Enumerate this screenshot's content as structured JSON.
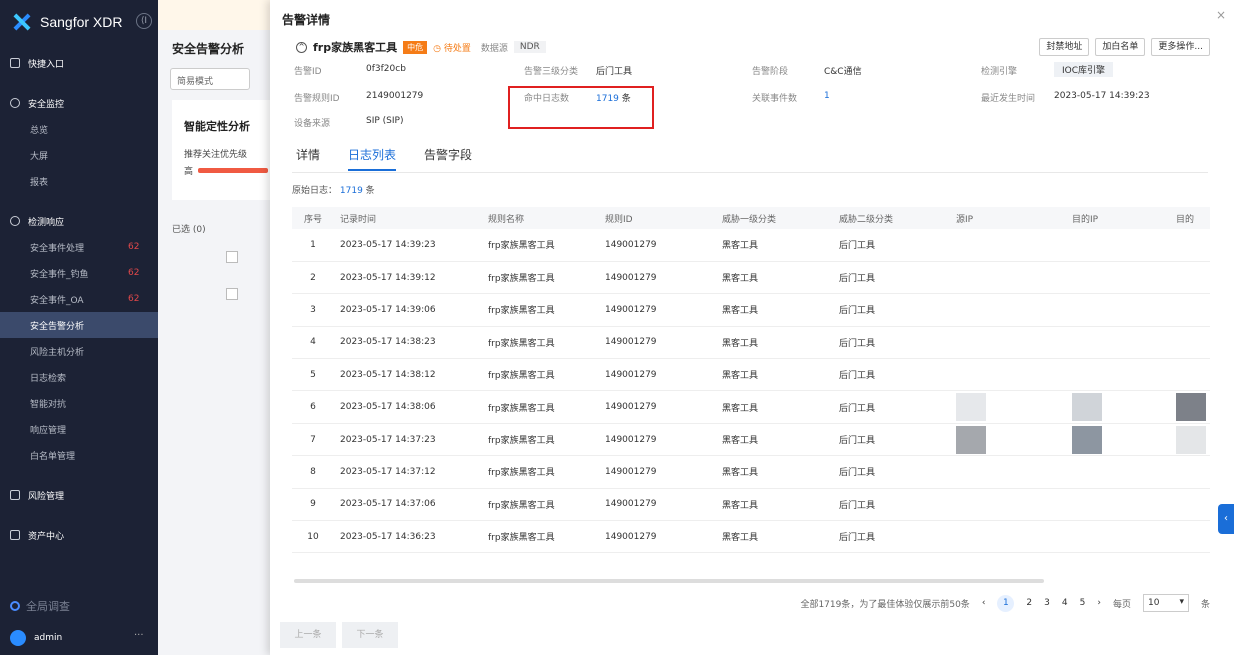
{
  "sidebar": {
    "brand": "Sangfor XDR",
    "collapse": "⟨I",
    "sections": [
      {
        "label": "快捷入口",
        "items": []
      },
      {
        "label": "安全监控",
        "items": [
          {
            "label": "总览"
          },
          {
            "label": "大屏"
          },
          {
            "label": "报表"
          }
        ]
      },
      {
        "label": "检测响应",
        "items": [
          {
            "label": "安全事件处理",
            "badge": "62"
          },
          {
            "label": "安全事件_钓鱼",
            "badge": "62"
          },
          {
            "label": "安全事件_OA",
            "badge": "62"
          },
          {
            "label": "安全告警分析",
            "active": true
          },
          {
            "label": "风险主机分析"
          },
          {
            "label": "日志检索"
          },
          {
            "label": "智能对抗"
          },
          {
            "label": "响应管理"
          },
          {
            "label": "白名单管理"
          }
        ]
      },
      {
        "label": "风险管理",
        "items": []
      },
      {
        "label": "资产中心",
        "items": []
      }
    ],
    "search_label": "全局调查",
    "user": "admin",
    "more": "···"
  },
  "bg": {
    "title": "安全告警分析",
    "mode": "简易模式",
    "card_title": "智能定性分析",
    "card_sub": "推荐关注优先级",
    "card_hi": "高",
    "selected": "已选 (0)"
  },
  "dialog": {
    "title": "告警详情",
    "close": "×",
    "alert_name": "frp家族黑客工具",
    "severity": "中危",
    "status": "待处置",
    "source_label": "数据源",
    "source_value": "NDR",
    "buttons": [
      "封禁地址",
      "加白名单",
      "更多操作..."
    ],
    "fields": {
      "alert_id_label": "告警ID",
      "alert_id": "0f3f20cb",
      "rule_id_label": "告警规则ID",
      "rule_id": "2149001279",
      "device_label": "设备来源",
      "device": "SIP (SIP)",
      "class3_label": "告警三级分类",
      "class3": "后门工具",
      "hit_label": "命中日志数",
      "hit_num": "1719",
      "hit_unit": "条",
      "stage_label": "告警阶段",
      "stage": "C&C通信",
      "related_label": "关联事件数",
      "related": "1",
      "engine_label": "检测引擎",
      "engine": "IOC库引擎",
      "last_label": "最近发生时间",
      "last": "2023-05-17 14:39:23"
    },
    "tabs": [
      "详情",
      "日志列表",
      "告警字段"
    ],
    "raw_label": "原始日志：",
    "raw_count": "1719",
    "raw_unit": "条",
    "columns": [
      "序号",
      "记录时间",
      "规则名称",
      "规则ID",
      "威胁一级分类",
      "威胁二级分类",
      "源IP",
      "目的IP",
      "目的"
    ],
    "rows": [
      [
        "1",
        "2023-05-17 14:39:23",
        "frp家族黑客工具",
        "149001279",
        "黑客工具",
        "后门工具"
      ],
      [
        "2",
        "2023-05-17 14:39:12",
        "frp家族黑客工具",
        "149001279",
        "黑客工具",
        "后门工具"
      ],
      [
        "3",
        "2023-05-17 14:39:06",
        "frp家族黑客工具",
        "149001279",
        "黑客工具",
        "后门工具"
      ],
      [
        "4",
        "2023-05-17 14:38:23",
        "frp家族黑客工具",
        "149001279",
        "黑客工具",
        "后门工具"
      ],
      [
        "5",
        "2023-05-17 14:38:12",
        "frp家族黑客工具",
        "149001279",
        "黑客工具",
        "后门工具"
      ],
      [
        "6",
        "2023-05-17 14:38:06",
        "frp家族黑客工具",
        "149001279",
        "黑客工具",
        "后门工具"
      ],
      [
        "7",
        "2023-05-17 14:37:23",
        "frp家族黑客工具",
        "149001279",
        "黑客工具",
        "后门工具"
      ],
      [
        "8",
        "2023-05-17 14:37:12",
        "frp家族黑客工具",
        "149001279",
        "黑客工具",
        "后门工具"
      ],
      [
        "9",
        "2023-05-17 14:37:06",
        "frp家族黑客工具",
        "149001279",
        "黑客工具",
        "后门工具"
      ],
      [
        "10",
        "2023-05-17 14:36:23",
        "frp家族黑客工具",
        "149001279",
        "黑客工具",
        "后门工具"
      ]
    ],
    "pager": {
      "summary": "全部1719条，为了最佳体验仅展示前50条",
      "prev": "‹",
      "pages": [
        "1",
        "2",
        "3",
        "4",
        "5"
      ],
      "next": "›",
      "per_page_label": "每页",
      "per_page": "10",
      "unit": "条"
    },
    "footer": [
      "上一条",
      "下一条"
    ]
  },
  "colors": {
    "accent": "#1a6ed8",
    "severity": "#f57c17",
    "highlight_box": "#e02020",
    "sidebar": "#1c2235"
  }
}
